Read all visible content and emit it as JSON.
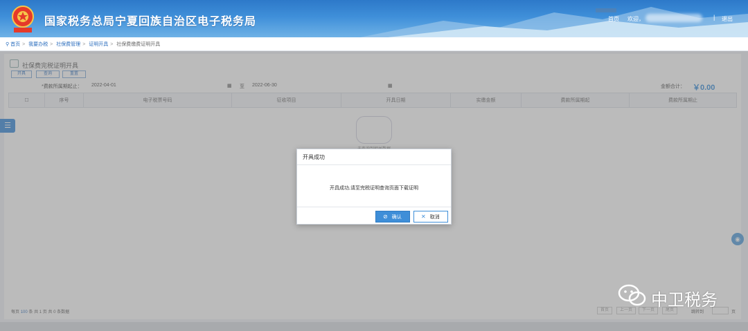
{
  "header": {
    "site_title": "国家税务总局宁夏回族自治区电子税务局",
    "home_link": "首页",
    "welcome": "欢迎，",
    "logout": "退出"
  },
  "breadcrumb": [
    "首页",
    "我要办税",
    "社保费管理",
    "证明开具",
    "社保费缴费证明开具"
  ],
  "page": {
    "title": "社保费完税证明开具",
    "toolbar": [
      "开具",
      "查询",
      "重置"
    ],
    "filter": {
      "label": "*费款所属期起止：",
      "start": "2022-04-01",
      "to": "至",
      "end": "2022-06-30"
    },
    "total_label": "金额合计：",
    "total_value": "￥0.00",
    "columns": [
      "序号",
      "电子税票号码",
      "征收项目",
      "开具日期",
      "实缴金额",
      "费款所属期起",
      "费款所属期止"
    ],
    "empty_text": "未查询到相关数据",
    "pager": {
      "per_page_label": "每页",
      "per_page": "100",
      "per_page_unit": "条",
      "pages": "共 1 页",
      "records": "共 0 条数据",
      "first": "首页",
      "prev": "上一页",
      "next": "下一页",
      "last": "尾页",
      "jump": "跳转到",
      "page_unit": "页"
    }
  },
  "modal": {
    "title": "开具成功",
    "message": "开具成功,请至完税证明查询页面下载证明",
    "ok": "确认",
    "cancel": "取消"
  },
  "watermark": "中卫税务",
  "colors": {
    "header_blue": "#2d79c9",
    "accent": "#3e8ed8",
    "total": "#2a86d9"
  }
}
